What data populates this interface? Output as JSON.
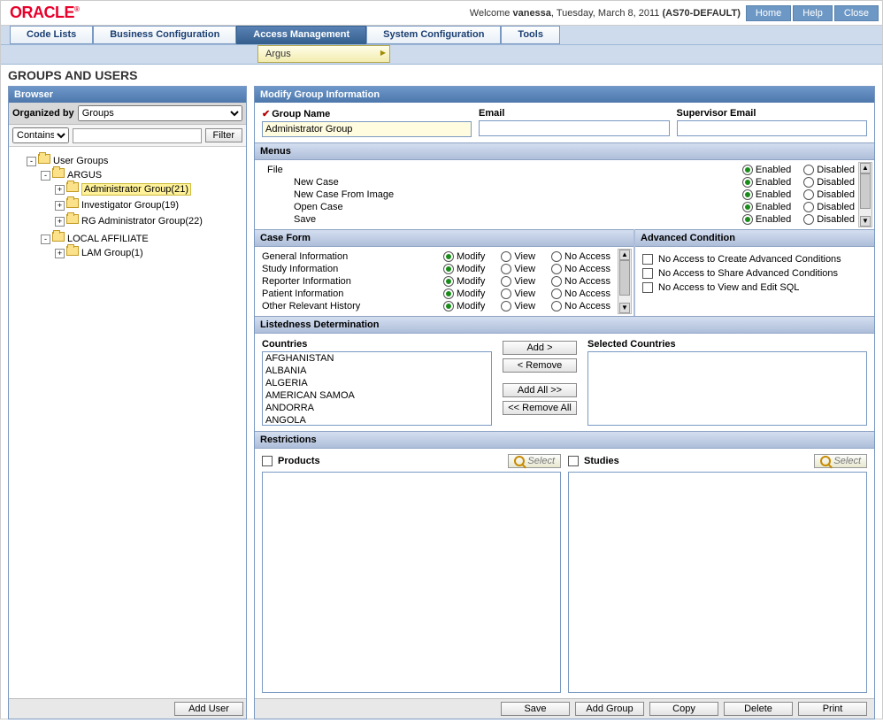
{
  "top": {
    "logo": "ORACLE",
    "welcome_prefix": "Welcome ",
    "user": "vanessa",
    "date": ", Tuesday, March 8, 2011 ",
    "env": "(AS70-DEFAULT)",
    "buttons": {
      "home": "Home",
      "help": "Help",
      "close": "Close"
    }
  },
  "menubar": {
    "tabs": [
      "Code Lists",
      "Business Configuration",
      "Access Management",
      "System Configuration",
      "Tools"
    ],
    "active_index": 2,
    "submenu": "Argus"
  },
  "page_title": "GROUPS AND USERS",
  "browser": {
    "title": "Browser",
    "organized_by_label": "Organized by",
    "organized_by_value": "Groups",
    "match_mode": "Contains",
    "filter_value": "",
    "filter_btn": "Filter",
    "add_user_btn": "Add User",
    "tree": {
      "root": "User Groups",
      "n1": "ARGUS",
      "n1a": "Administrator Group(21)",
      "n1b": "Investigator Group(19)",
      "n1c": "RG Administrator Group(22)",
      "n2": "LOCAL AFFILIATE",
      "n2a": "LAM Group(1)"
    }
  },
  "modify": {
    "title": "Modify Group Information",
    "group_name_label": "Group Name",
    "group_name_value": "Administrator Group",
    "email_label": "Email",
    "supervisor_label": "Supervisor Email",
    "menus_hdr": "Menus",
    "enabled": "Enabled",
    "disabled": "Disabled",
    "menu_items": {
      "m0": "File",
      "m1": "New Case",
      "m2": "New Case From Image",
      "m3": "Open Case",
      "m4": "Save"
    },
    "case_form_hdr": "Case Form",
    "modify_lbl": "Modify",
    "view_lbl": "View",
    "noaccess_lbl": "No Access",
    "cf_items": {
      "c0": "General Information",
      "c1": "Study Information",
      "c2": "Reporter Information",
      "c3": "Patient Information",
      "c4": "Other Relevant History"
    },
    "adv_hdr": "Advanced Condition",
    "adv": {
      "a0": "No Access to Create Advanced Conditions",
      "a1": "No Access to Share Advanced Conditions",
      "a2": "No Access to View and Edit SQL"
    },
    "ld_hdr": "Listedness Determination",
    "countries_lbl": "Countries",
    "selected_lbl": "Selected Countries",
    "countries": {
      "c0": "AFGHANISTAN",
      "c1": "ALBANIA",
      "c2": "ALGERIA",
      "c3": "AMERICAN SAMOA",
      "c4": "ANDORRA",
      "c5": "ANGOLA"
    },
    "btns": {
      "add": "Add >",
      "remove": "< Remove",
      "addall": "Add All >>",
      "removeall": "<< Remove All"
    },
    "restr_hdr": "Restrictions",
    "products_lbl": "Products",
    "studies_lbl": "Studies",
    "select_lbl": "Select"
  },
  "footer": {
    "save": "Save",
    "addgroup": "Add Group",
    "copy": "Copy",
    "delete": "Delete",
    "print": "Print"
  }
}
